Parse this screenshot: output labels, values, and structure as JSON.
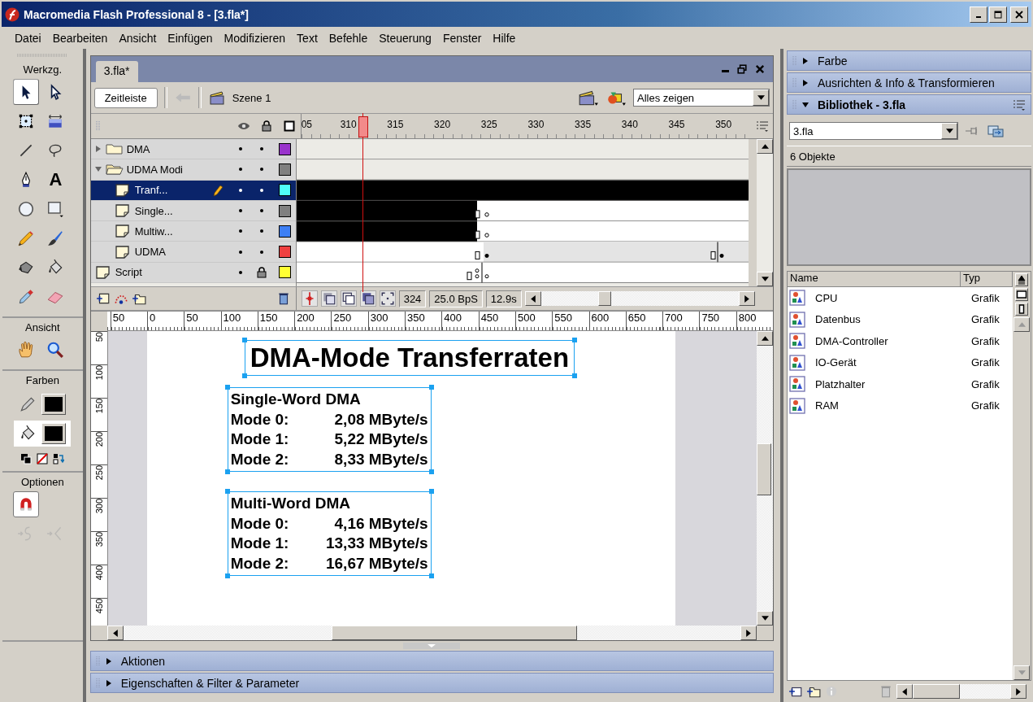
{
  "window": {
    "title": "Macromedia Flash Professional 8 - [3.fla*]"
  },
  "menu": [
    "Datei",
    "Bearbeiten",
    "Ansicht",
    "Einfügen",
    "Modifizieren",
    "Text",
    "Befehle",
    "Steuerung",
    "Fenster",
    "Hilfe"
  ],
  "toolbox": {
    "sections": [
      {
        "title": "Werkzg.",
        "tools": [
          {
            "selected": true
          },
          {
            "selected": false
          },
          {
            "selected": false
          },
          {
            "selected": false
          },
          {
            "selected": false
          },
          {
            "selected": false
          },
          {
            "selected": false
          },
          {
            "selected": false,
            "glyph": "A"
          },
          {
            "selected": false
          },
          {
            "selected": false
          },
          {
            "selected": false
          },
          {
            "selected": false
          },
          {
            "selected": false
          },
          {
            "selected": false
          },
          {
            "selected": false
          },
          {
            "selected": false
          }
        ]
      },
      {
        "title": "Ansicht",
        "tools": [
          {
            "selected": false
          },
          {
            "selected": false
          }
        ]
      },
      {
        "title": "Farben",
        "swatches": [
          {
            "color": "#000000",
            "selected": false
          },
          {
            "color": "#000000",
            "selected": true
          }
        ]
      },
      {
        "title": "Optionen",
        "options": [
          {
            "on": true,
            "disabled": false
          },
          {
            "on": false,
            "disabled": true
          },
          {
            "on": false,
            "disabled": true
          }
        ]
      }
    ]
  },
  "document": {
    "tab": "3.fla*",
    "timeline_button": "Zeitleiste",
    "scene": "Szene 1",
    "zoom": "Alles zeigen",
    "frame_ruler": [
      "05",
      "310",
      "315",
      "320",
      "325",
      "330",
      "335",
      "340",
      "345",
      "350"
    ],
    "layers": [
      {
        "name": "DMA",
        "kind": "folder",
        "expanded": false,
        "selected": false,
        "locked": false,
        "color": "#9933cc"
      },
      {
        "name": "UDMA Modi",
        "kind": "folder",
        "expanded": true,
        "selected": false,
        "locked": false,
        "color": "#808080",
        "children": [
          {
            "name": "Tranf...",
            "kind": "layer",
            "selected": true,
            "locked": false,
            "color": "#4ffff8"
          },
          {
            "name": "Single...",
            "kind": "layer",
            "selected": false,
            "locked": false,
            "color": "#808080"
          },
          {
            "name": "Multiw...",
            "kind": "layer",
            "selected": false,
            "locked": false,
            "color": "#3d7ff5"
          },
          {
            "name": "UDMA",
            "kind": "layer",
            "selected": false,
            "locked": false,
            "color": "#f04040"
          }
        ]
      },
      {
        "name": "Script",
        "kind": "layer",
        "selected": false,
        "locked": true,
        "color": "#ffff33"
      }
    ],
    "frame": "324",
    "rate": "25.0 BpS",
    "time": "12.9s",
    "h_ruler": [
      "50",
      "0",
      "50",
      "100",
      "150",
      "200",
      "250",
      "300",
      "350",
      "400",
      "450",
      "500",
      "550",
      "600",
      "650",
      "700",
      "750",
      "800"
    ],
    "v_ruler": [
      "50",
      "100",
      "150",
      "200",
      "250",
      "300",
      "350",
      "400",
      "450"
    ],
    "stage": {
      "title": "DMA-Mode Transferraten",
      "blocks": [
        {
          "heading": "Single-Word DMA",
          "rows": [
            {
              "label": "Mode 0:",
              "value": "2,08 MByte/s"
            },
            {
              "label": "Mode 1:",
              "value": "5,22 MByte/s"
            },
            {
              "label": "Mode 2:",
              "value": "8,33 MByte/s"
            }
          ]
        },
        {
          "heading": "Multi-Word DMA",
          "rows": [
            {
              "label": "Mode 0:",
              "value": "4,16 MByte/s"
            },
            {
              "label": "Mode 1:",
              "value": "13,33 MByte/s"
            },
            {
              "label": "Mode 2:",
              "value": "16,67 MByte/s"
            }
          ]
        }
      ]
    }
  },
  "bottom_panels": [
    {
      "title": "Aktionen",
      "expanded": false
    },
    {
      "title": "Eigenschaften & Filter & Parameter",
      "expanded": false
    }
  ],
  "right_panels": [
    {
      "title": "Farbe",
      "expanded": false
    },
    {
      "title": "Ausrichten & Info & Transformieren",
      "expanded": false
    },
    {
      "title": "Bibliothek - 3.fla",
      "expanded": true
    }
  ],
  "library": {
    "source": "3.fla",
    "count": "6 Objekte",
    "columns": [
      "Name",
      "Typ"
    ],
    "items": [
      {
        "name": "CPU",
        "type": "Grafik"
      },
      {
        "name": "Datenbus",
        "type": "Grafik"
      },
      {
        "name": "DMA-Controller",
        "type": "Grafik"
      },
      {
        "name": "IO-Gerät",
        "type": "Grafik"
      },
      {
        "name": "Platzhalter",
        "type": "Grafik"
      },
      {
        "name": "RAM",
        "type": "Grafik"
      }
    ]
  }
}
